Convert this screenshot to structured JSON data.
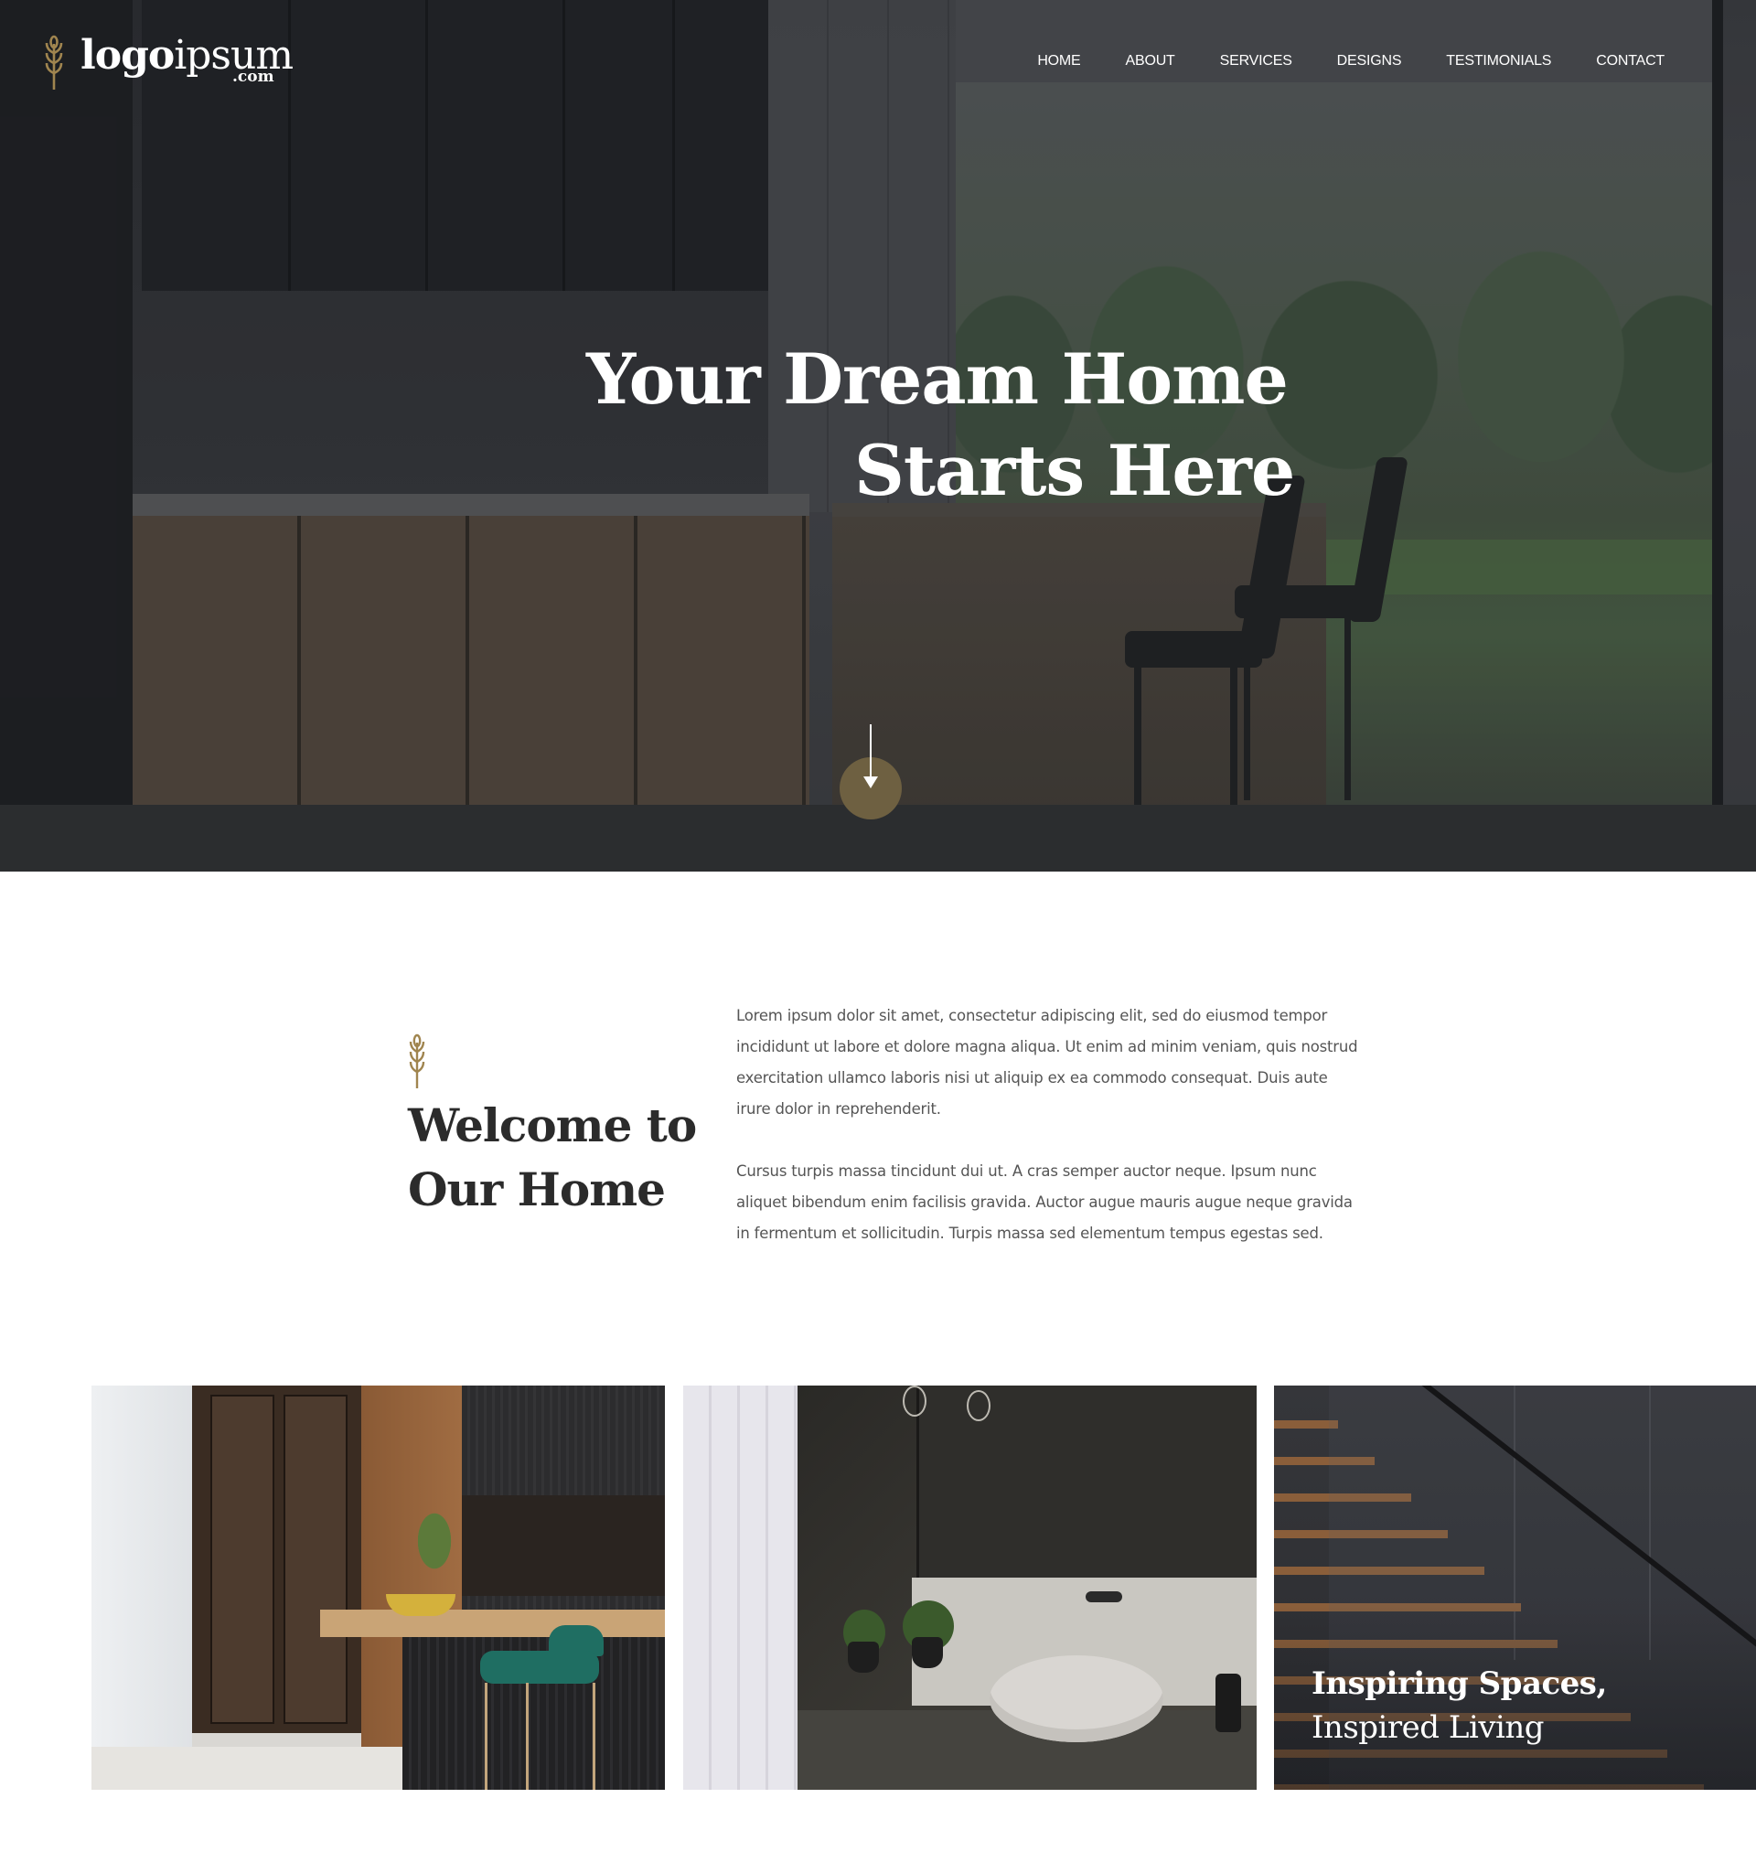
{
  "brand": {
    "logo_word_bold": "logo",
    "logo_word_regular": "ipsum",
    "logo_suffix": ".com",
    "accent_color": "#a0854f",
    "icon": "wheat-icon"
  },
  "nav": {
    "items": [
      {
        "label": "HOME"
      },
      {
        "label": "ABOUT"
      },
      {
        "label": "SERVICES"
      },
      {
        "label": "DESIGNS"
      },
      {
        "label": "TESTIMONIALS"
      },
      {
        "label": "CONTACT"
      }
    ]
  },
  "hero": {
    "title_regular": "Your ",
    "title_bold": "Dream Home",
    "title_line2": "Starts Here",
    "scroll_icon": "arrow-down-icon",
    "scroll_button_color": "#6e6041"
  },
  "welcome": {
    "title_line1": "Welcome to",
    "title_line2": "Our Home",
    "paragraph1": "Lorem ipsum dolor sit amet, consectetur adipiscing elit, sed do eiusmod tempor incididunt ut labore et dolore magna aliqua. Ut enim ad minim veniam, quis nostrud exercitation ullamco laboris nisi ut aliquip ex ea commodo consequat. Duis aute irure dolor in reprehenderit.",
    "paragraph2": "Cursus turpis massa tincidunt dui ut. A cras semper auctor neque. Ipsum nunc aliquet bibendum enim facilisis gravida. Auctor augue mauris augue neque gravida in fermentum et sollicitudin. Turpis massa sed elementum tempus egestas sed."
  },
  "gallery": {
    "cards": [
      {
        "subject": "kitchen"
      },
      {
        "subject": "bathroom"
      },
      {
        "subject": "staircase",
        "caption_bold": "Inspiring Spaces,",
        "caption_regular": "Inspired Living"
      }
    ]
  }
}
